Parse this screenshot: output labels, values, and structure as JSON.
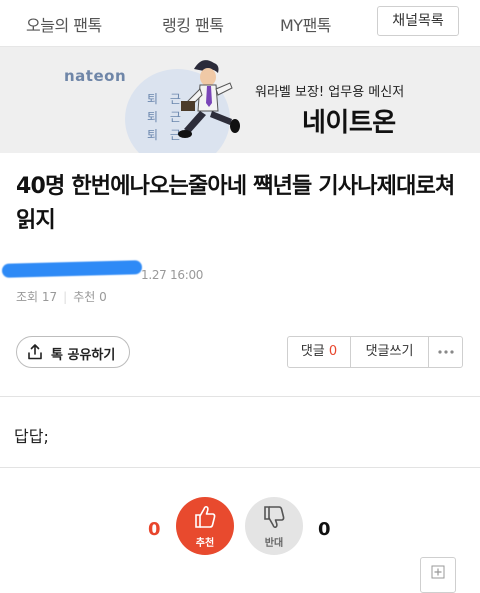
{
  "nav": {
    "tabs": [
      "오늘의 팬톡",
      "랭킹 팬톡",
      "MY팬톡"
    ],
    "channel_button": "채널목록"
  },
  "banner": {
    "logo_text": "nateon",
    "side_text": [
      "퇴 근",
      "퇴 근",
      "퇴 근"
    ],
    "subtitle": "워라벨 보장! 업무용 메신저",
    "brand": "네이트온",
    "colors": {
      "background": "#efefef",
      "logo": "#6f86a8",
      "circle": "#dbe3ef"
    }
  },
  "post": {
    "title": "40명 한번에나오는줄아네 쨱년들 기사나제대로쳐 읽지",
    "date": "1.27 16:00",
    "views_label": "조회 17",
    "recommend_label": "추천 0",
    "body": "답답;"
  },
  "actions": {
    "share_label": "톡 공유하기",
    "share_icon": "share-upload-icon",
    "comments_label": "댓글",
    "comments_count": "0",
    "write_comment_label": "댓글쓰기",
    "more_icon": "more-dots-icon"
  },
  "votes": {
    "up_count": "0",
    "up_label": "추천",
    "up_icon": "thumbs-up-icon",
    "down_count": "0",
    "down_label": "반대",
    "down_icon": "thumbs-down-icon"
  },
  "floating": {
    "icon": "plus-icon"
  },
  "colors": {
    "accent": "#e84a2e",
    "redacted_author": "#2e8af6"
  }
}
